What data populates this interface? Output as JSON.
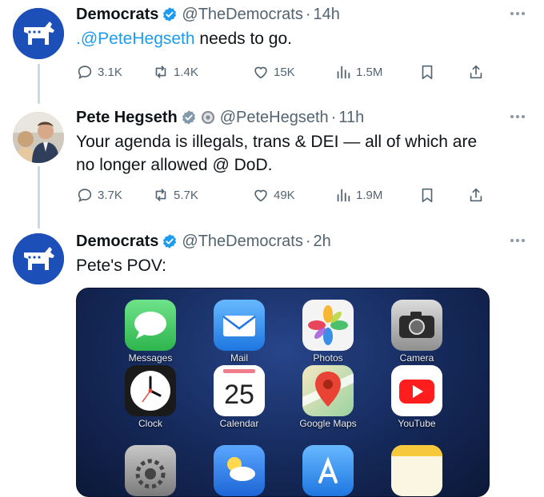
{
  "tweets": [
    {
      "name": "Democrats",
      "handle": "@TheDemocrats",
      "separator": "·",
      "time": "14h",
      "text_mention": ".@PeteHegseth",
      "text_rest": " needs to go.",
      "stats": {
        "replies": "3.1K",
        "retweets": "1.4K",
        "likes": "15K",
        "views": "1.5M"
      }
    },
    {
      "name": "Pete Hegseth",
      "handle": "@PeteHegseth",
      "separator": "·",
      "time": "11h",
      "text": "Your agenda is illegals, trans & DEI — all of which are no longer allowed @ DoD.",
      "stats": {
        "replies": "3.7K",
        "retweets": "5.7K",
        "likes": "49K",
        "views": "1.9M"
      }
    },
    {
      "name": "Democrats",
      "handle": "@TheDemocrats",
      "separator": "·",
      "time": "2h",
      "text": "Pete's POV:"
    }
  ],
  "media": {
    "apps": [
      {
        "label": "Messages",
        "icon": "messages-icon"
      },
      {
        "label": "Mail",
        "icon": "mail-icon"
      },
      {
        "label": "Photos",
        "icon": "photos-icon"
      },
      {
        "label": "Camera",
        "icon": "camera-icon"
      },
      {
        "label": "Clock",
        "icon": "clock-icon"
      },
      {
        "label": "Calendar",
        "icon": "calendar-icon",
        "day": "25"
      },
      {
        "label": "Google Maps",
        "icon": "google-maps-icon"
      },
      {
        "label": "YouTube",
        "icon": "youtube-icon"
      }
    ]
  },
  "colors": {
    "link": "#1d9bf0",
    "verified": "#1d9bf0",
    "party_blue": "#1d4fb8",
    "muted": "#536471"
  }
}
